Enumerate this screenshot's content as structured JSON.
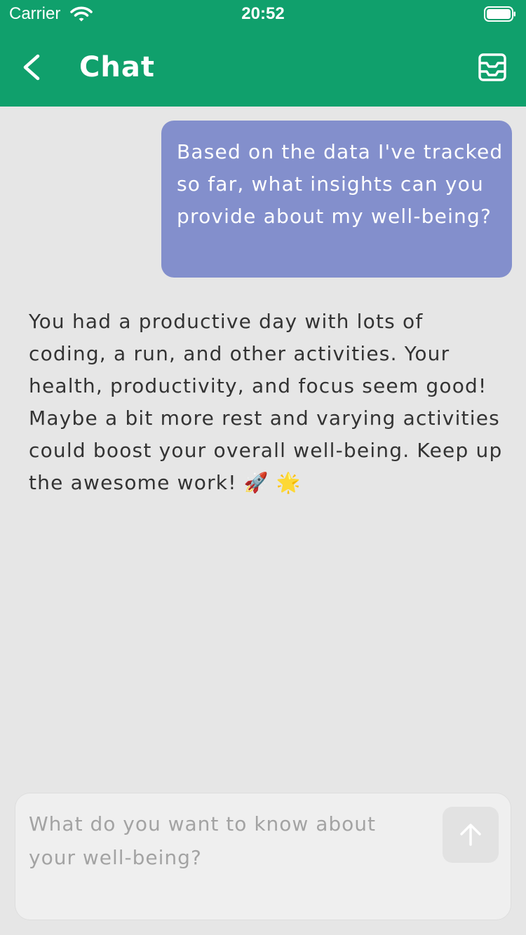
{
  "status_bar": {
    "carrier": "Carrier",
    "time": "20:52",
    "wifi_icon": "wifi-icon",
    "battery_icon": "battery-icon"
  },
  "nav_bar": {
    "title": "Chat",
    "back_icon": "chevron-left-icon",
    "history_icon": "inbox-icon",
    "background_color": "#10a06c"
  },
  "messages": [
    {
      "role": "user",
      "text": "Based on the data I've tracked so far, what insights can you provide about my well-being?",
      "bubble_color": "#838fcc"
    },
    {
      "role": "assistant",
      "text": "You had a productive day with lots of coding, a run, and other activities. Your health, productivity, and focus seem good! Maybe a bit more rest and varying activities could boost your overall well-being. Keep up the awesome work! 🚀 🌟"
    }
  ],
  "composer": {
    "placeholder": "What do you want to know about your well-being?",
    "value": "",
    "send_icon": "arrow-up-icon"
  }
}
